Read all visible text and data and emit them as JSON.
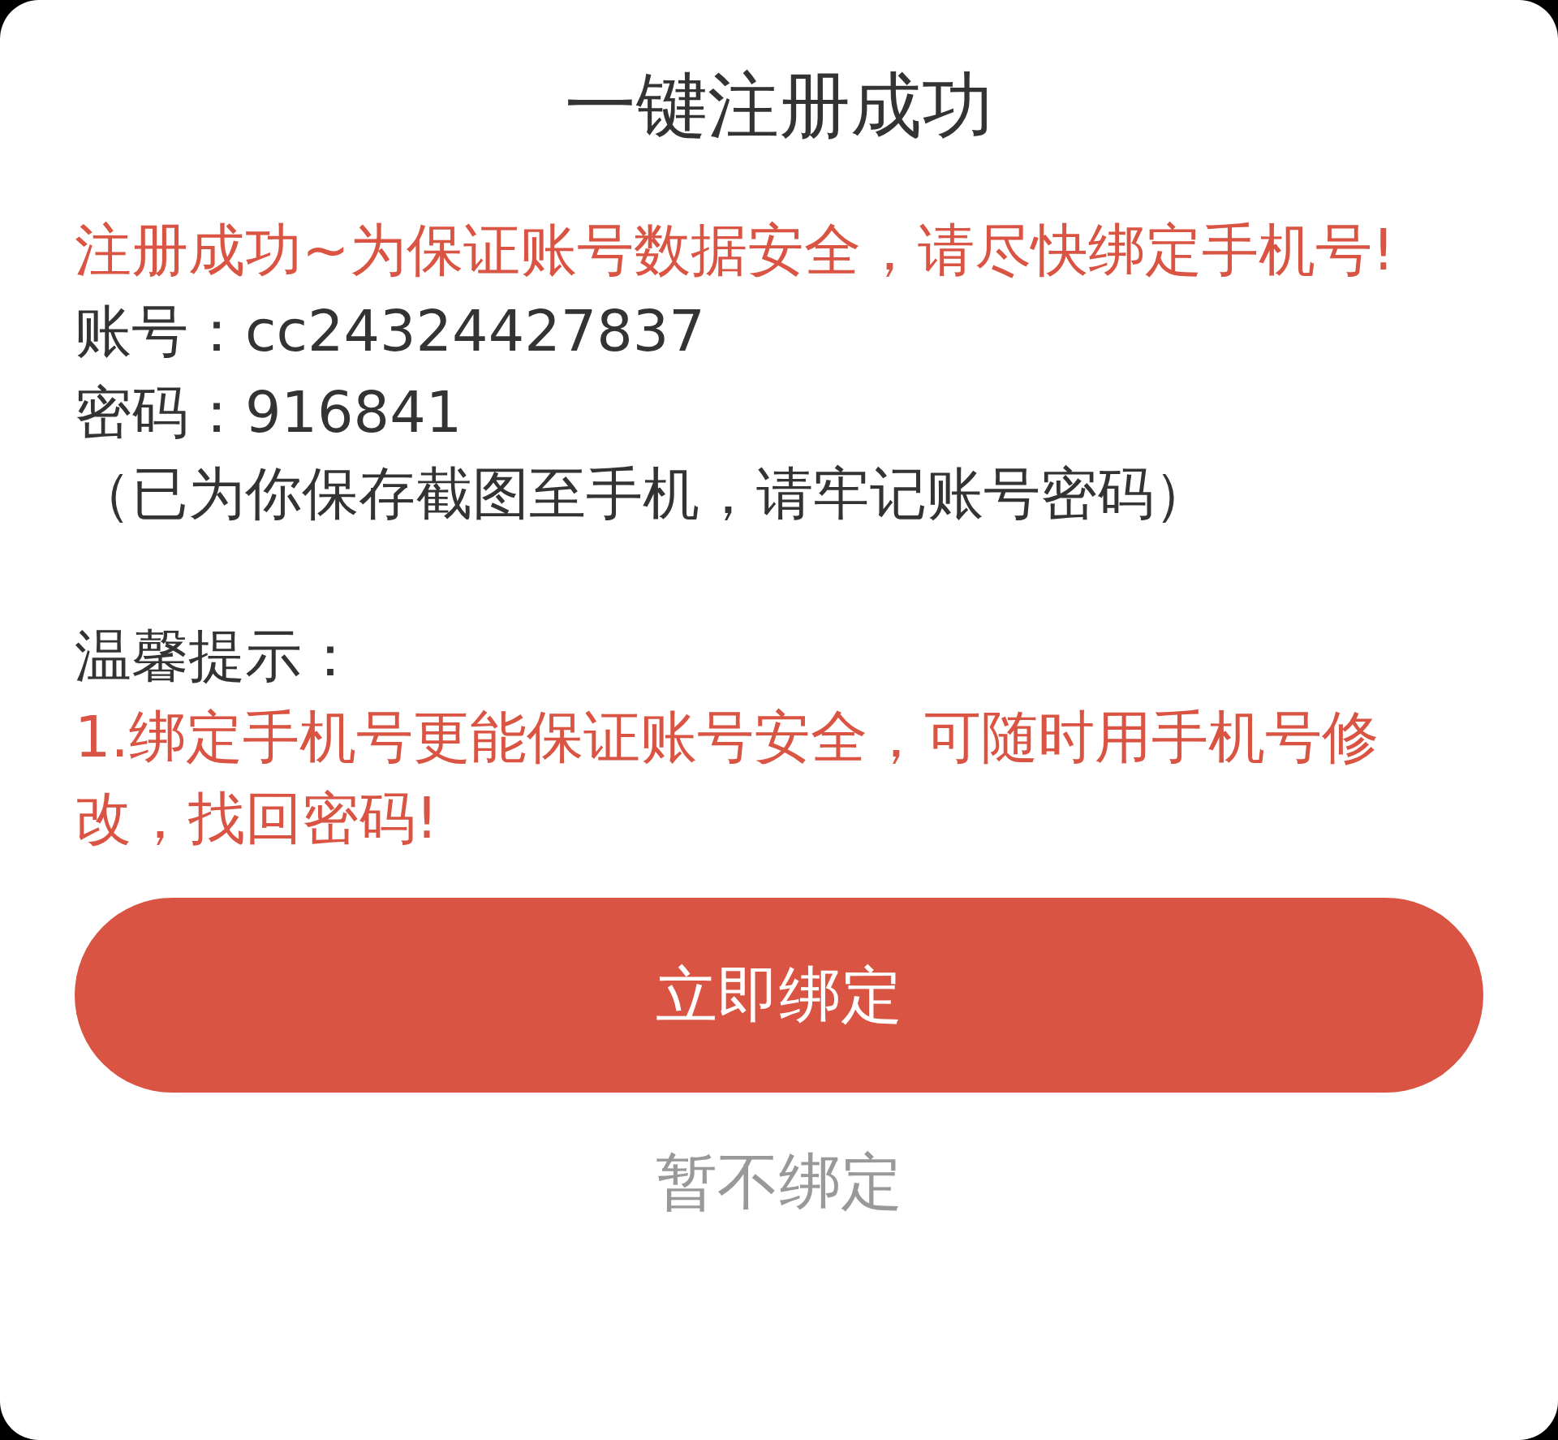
{
  "dialog": {
    "title": "一键注册成功",
    "paragraphs": [
      {
        "kind": "warning",
        "text": "注册成功~为保证账号数据安全，请尽快绑定手机号!"
      },
      {
        "kind": "normal",
        "text": "账号：cc24324427837"
      },
      {
        "kind": "normal",
        "text": "密码：916841"
      },
      {
        "kind": "normal",
        "text": "（已为你保存截图至手机，请牢记账号密码）"
      },
      {
        "kind": "heading",
        "text": "温馨提示："
      },
      {
        "kind": "warning",
        "text": "1.绑定手机号更能保证账号安全，可随时用手机号修改，找回密码!"
      }
    ],
    "primary_button": "立即绑定",
    "secondary_button": "暂不绑定"
  }
}
